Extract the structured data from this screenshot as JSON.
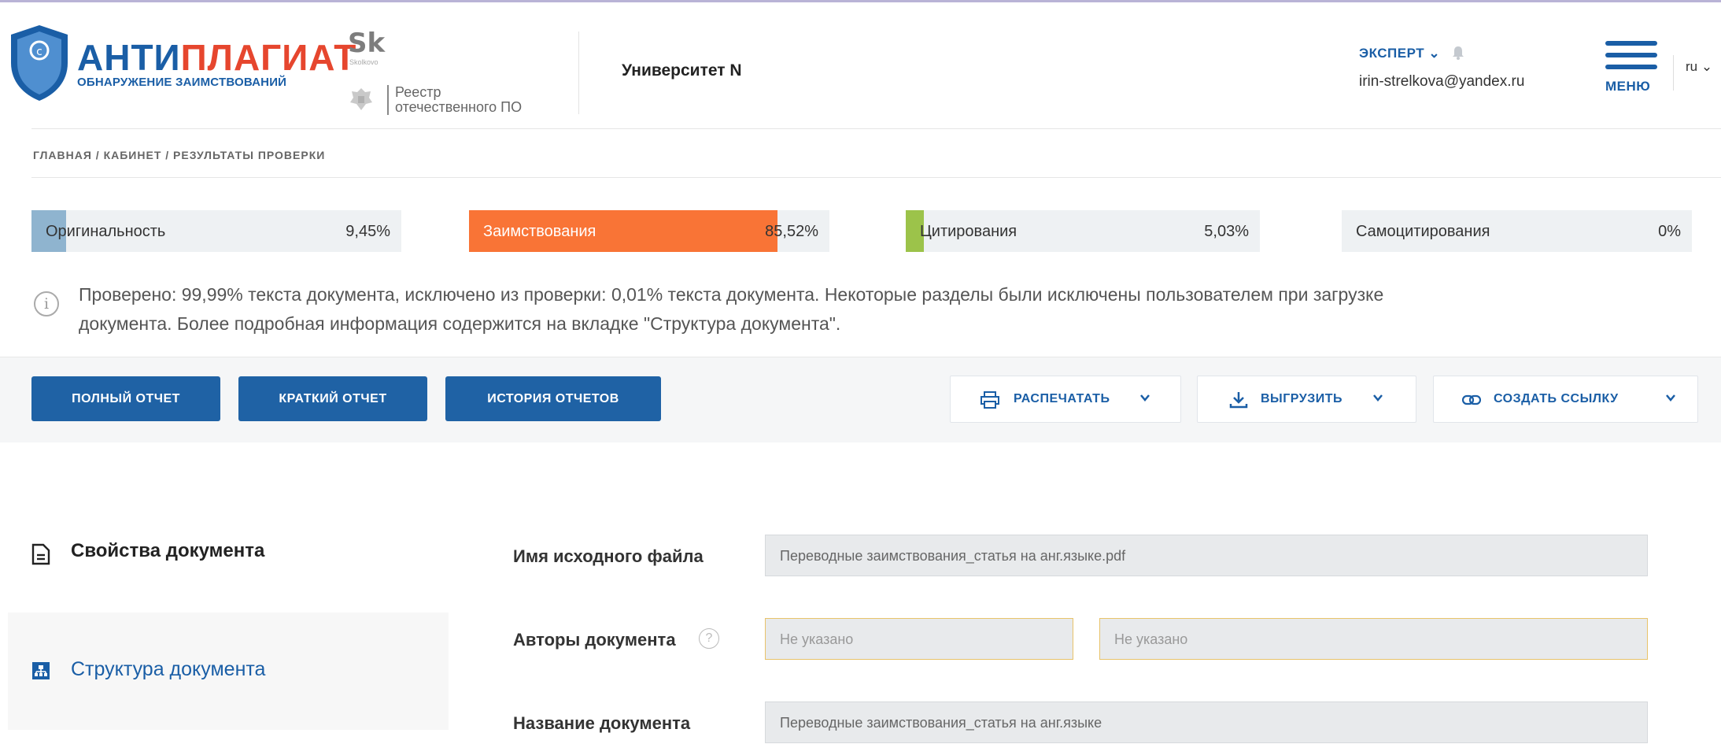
{
  "header": {
    "logo_title_a": "АНТИ",
    "logo_title_b": "ПЛАГИАТ",
    "logo_subtitle": "ОБНАРУЖЕНИЕ ЗАИМСТВОВАНИЙ",
    "sk_logo": "Sk",
    "sk_small": "Skolkovo",
    "reestr": [
      "Реестр",
      "отечественного ПО"
    ],
    "organization": "Университет N",
    "role": "ЭКСПЕРТ",
    "email": "irin-strelkova@yandex.ru",
    "menu_label": "МЕНЮ",
    "lang": "ru"
  },
  "breadcrumb": "ГЛАВНАЯ / КАБИНЕТ / РЕЗУЛЬТАТЫ ПРОВЕРКИ",
  "metrics": [
    {
      "label": "Оригинальность",
      "value": "9,45%",
      "fraction": 0.0945,
      "color": "#8fb4cf"
    },
    {
      "label": "Заимствования",
      "value": "85,52%",
      "fraction": 0.8552,
      "color": "#f97436"
    },
    {
      "label": "Цитирования",
      "value": "5,03%",
      "fraction": 0.0503,
      "color": "#9cc34a"
    },
    {
      "label": "Самоцитирования",
      "value": "0%",
      "fraction": 0.0,
      "color": "#8fb4cf"
    }
  ],
  "info": {
    "line1": "Проверено: 99,99% текста документа, исключено из проверки: 0,01% текста документа. Некоторые разделы были исключены пользователем при загрузке",
    "line2": "документа. Более подробная информация содержится на вкладке \"Структура документа\"."
  },
  "toolbar": {
    "full_report": "ПОЛНЫЙ ОТЧЕТ",
    "short_report": "КРАТКИЙ ОТЧЕТ",
    "history": "ИСТОРИЯ ОТЧЕТОВ",
    "print": "РАСПЕЧАТАТЬ",
    "export": "ВЫГРУЗИТЬ",
    "link": "СОЗДАТЬ ССЫЛКУ"
  },
  "sidebar": {
    "properties": "Свойства документа",
    "structure": "Структура документа"
  },
  "form": {
    "file_label": "Имя исходного файла",
    "file_value": "Переводные заимствования_статья на анг.языке.pdf",
    "authors_label": "Авторы документа",
    "author1_placeholder": "Не указано",
    "author2_placeholder": "Не указано",
    "title_label": "Название документа",
    "title_value": "Переводные заимствования_статья на анг.языке"
  },
  "colors": {
    "brand": "#1a5ea6",
    "accent_red": "#e6462e",
    "borrow": "#f97436"
  }
}
